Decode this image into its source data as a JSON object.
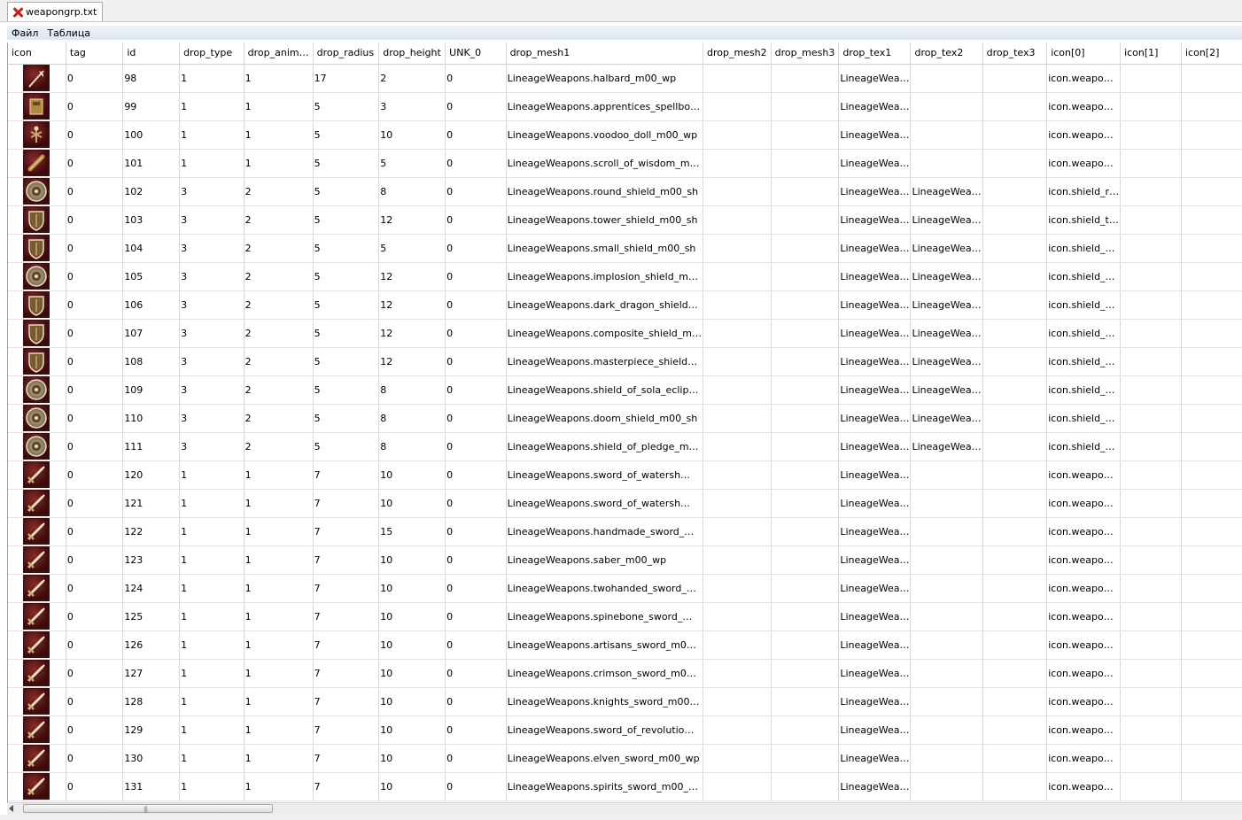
{
  "window": {
    "tab_title": "weapongrp.txt"
  },
  "menu": [
    "Файл",
    "Таблица"
  ],
  "columns": [
    "icon",
    "tag",
    "id",
    "drop_type",
    "drop_anim…",
    "drop_radius",
    "drop_height",
    "UNK_0",
    "drop_mesh1",
    "drop_mesh2",
    "drop_mesh3",
    "drop_tex1",
    "drop_tex2",
    "drop_tex3",
    "icon[0]",
    "icon[1]",
    "icon[2]"
  ],
  "rows": [
    {
      "icon": "halberd-icon",
      "tag": "0",
      "id": "98",
      "drop_type": "1",
      "drop_anim": "1",
      "drop_radius": "17",
      "drop_height": "2",
      "unk0": "0",
      "drop_mesh1": "LineageWeapons.halbard_m00_wp",
      "drop_tex1": "LineageWea…",
      "drop_tex2": "",
      "icon0": "icon.weapo…"
    },
    {
      "icon": "spellbook-icon",
      "tag": "0",
      "id": "99",
      "drop_type": "1",
      "drop_anim": "1",
      "drop_radius": "5",
      "drop_height": "3",
      "unk0": "0",
      "drop_mesh1": "LineageWeapons.apprentices_spellbo…",
      "drop_tex1": "LineageWea…",
      "drop_tex2": "",
      "icon0": "icon.weapo…"
    },
    {
      "icon": "voodoo-doll-icon",
      "tag": "0",
      "id": "100",
      "drop_type": "1",
      "drop_anim": "1",
      "drop_radius": "5",
      "drop_height": "10",
      "unk0": "0",
      "drop_mesh1": "LineageWeapons.voodoo_doll_m00_wp",
      "drop_tex1": "LineageWea…",
      "drop_tex2": "",
      "icon0": "icon.weapo…"
    },
    {
      "icon": "scroll-icon",
      "tag": "0",
      "id": "101",
      "drop_type": "1",
      "drop_anim": "1",
      "drop_radius": "5",
      "drop_height": "5",
      "unk0": "0",
      "drop_mesh1": "LineageWeapons.scroll_of_wisdom_m…",
      "drop_tex1": "LineageWea…",
      "drop_tex2": "",
      "icon0": "icon.weapo…"
    },
    {
      "icon": "round-shield-icon",
      "tag": "0",
      "id": "102",
      "drop_type": "3",
      "drop_anim": "2",
      "drop_radius": "5",
      "drop_height": "8",
      "unk0": "0",
      "drop_mesh1": "LineageWeapons.round_shield_m00_sh",
      "drop_tex1": "LineageWea…",
      "drop_tex2": "LineageWea…",
      "icon0": "icon.shield_r…"
    },
    {
      "icon": "tower-shield-icon",
      "tag": "0",
      "id": "103",
      "drop_type": "3",
      "drop_anim": "2",
      "drop_radius": "5",
      "drop_height": "12",
      "unk0": "0",
      "drop_mesh1": "LineageWeapons.tower_shield_m00_sh",
      "drop_tex1": "LineageWea…",
      "drop_tex2": "LineageWea…",
      "icon0": "icon.shield_t…"
    },
    {
      "icon": "small-shield-icon",
      "tag": "0",
      "id": "104",
      "drop_type": "3",
      "drop_anim": "2",
      "drop_radius": "5",
      "drop_height": "5",
      "unk0": "0",
      "drop_mesh1": "LineageWeapons.small_shield_m00_sh",
      "drop_tex1": "LineageWea…",
      "drop_tex2": "LineageWea…",
      "icon0": "icon.shield_…"
    },
    {
      "icon": "implosion-shield-icon",
      "tag": "0",
      "id": "105",
      "drop_type": "3",
      "drop_anim": "2",
      "drop_radius": "5",
      "drop_height": "12",
      "unk0": "0",
      "drop_mesh1": "LineageWeapons.implosion_shield_m…",
      "drop_tex1": "LineageWea…",
      "drop_tex2": "LineageWea…",
      "icon0": "icon.shield_…"
    },
    {
      "icon": "dark-dragon-shield-icon",
      "tag": "0",
      "id": "106",
      "drop_type": "3",
      "drop_anim": "2",
      "drop_radius": "5",
      "drop_height": "12",
      "unk0": "0",
      "drop_mesh1": "LineageWeapons.dark_dragon_shield…",
      "drop_tex1": "LineageWea…",
      "drop_tex2": "LineageWea…",
      "icon0": "icon.shield_…"
    },
    {
      "icon": "composite-shield-icon",
      "tag": "0",
      "id": "107",
      "drop_type": "3",
      "drop_anim": "2",
      "drop_radius": "5",
      "drop_height": "12",
      "unk0": "0",
      "drop_mesh1": "LineageWeapons.composite_shield_m…",
      "drop_tex1": "LineageWea…",
      "drop_tex2": "LineageWea…",
      "icon0": "icon.shield_…"
    },
    {
      "icon": "masterpiece-shield-icon",
      "tag": "0",
      "id": "108",
      "drop_type": "3",
      "drop_anim": "2",
      "drop_radius": "5",
      "drop_height": "12",
      "unk0": "0",
      "drop_mesh1": "LineageWeapons.masterpiece_shield…",
      "drop_tex1": "LineageWea…",
      "drop_tex2": "LineageWea…",
      "icon0": "icon.shield_…"
    },
    {
      "icon": "sola-eclipse-shield-icon",
      "tag": "0",
      "id": "109",
      "drop_type": "3",
      "drop_anim": "2",
      "drop_radius": "5",
      "drop_height": "8",
      "unk0": "0",
      "drop_mesh1": "LineageWeapons.shield_of_sola_eclip…",
      "drop_tex1": "LineageWea…",
      "drop_tex2": "LineageWea…",
      "icon0": "icon.shield_…"
    },
    {
      "icon": "doom-shield-icon",
      "tag": "0",
      "id": "110",
      "drop_type": "3",
      "drop_anim": "2",
      "drop_radius": "5",
      "drop_height": "8",
      "unk0": "0",
      "drop_mesh1": "LineageWeapons.doom_shield_m00_sh",
      "drop_tex1": "LineageWea…",
      "drop_tex2": "LineageWea…",
      "icon0": "icon.shield_…"
    },
    {
      "icon": "pledge-shield-icon",
      "tag": "0",
      "id": "111",
      "drop_type": "3",
      "drop_anim": "2",
      "drop_radius": "5",
      "drop_height": "8",
      "unk0": "0",
      "drop_mesh1": "LineageWeapons.shield_of_pledge_m…",
      "drop_tex1": "LineageWea…",
      "drop_tex2": "LineageWea…",
      "icon0": "icon.shield_…"
    },
    {
      "icon": "sword-icon",
      "tag": "0",
      "id": "120",
      "drop_type": "1",
      "drop_anim": "1",
      "drop_radius": "7",
      "drop_height": "10",
      "unk0": "0",
      "drop_mesh1": "LineageWeapons.sword_of_watersh…",
      "drop_tex1": "LineageWea…",
      "drop_tex2": "",
      "icon0": "icon.weapo…"
    },
    {
      "icon": "sword-icon",
      "tag": "0",
      "id": "121",
      "drop_type": "1",
      "drop_anim": "1",
      "drop_radius": "7",
      "drop_height": "10",
      "unk0": "0",
      "drop_mesh1": "LineageWeapons.sword_of_watersh…",
      "drop_tex1": "LineageWea…",
      "drop_tex2": "",
      "icon0": "icon.weapo…"
    },
    {
      "icon": "sword-icon",
      "tag": "0",
      "id": "122",
      "drop_type": "1",
      "drop_anim": "1",
      "drop_radius": "7",
      "drop_height": "15",
      "unk0": "0",
      "drop_mesh1": "LineageWeapons.handmade_sword_…",
      "drop_tex1": "LineageWea…",
      "drop_tex2": "",
      "icon0": "icon.weapo…"
    },
    {
      "icon": "saber-icon",
      "tag": "0",
      "id": "123",
      "drop_type": "1",
      "drop_anim": "1",
      "drop_radius": "7",
      "drop_height": "10",
      "unk0": "0",
      "drop_mesh1": "LineageWeapons.saber_m00_wp",
      "drop_tex1": "LineageWea…",
      "drop_tex2": "",
      "icon0": "icon.weapo…"
    },
    {
      "icon": "sword-icon",
      "tag": "0",
      "id": "124",
      "drop_type": "1",
      "drop_anim": "1",
      "drop_radius": "7",
      "drop_height": "10",
      "unk0": "0",
      "drop_mesh1": "LineageWeapons.twohanded_sword_…",
      "drop_tex1": "LineageWea…",
      "drop_tex2": "",
      "icon0": "icon.weapo…"
    },
    {
      "icon": "sword-icon",
      "tag": "0",
      "id": "125",
      "drop_type": "1",
      "drop_anim": "1",
      "drop_radius": "7",
      "drop_height": "10",
      "unk0": "0",
      "drop_mesh1": "LineageWeapons.spinebone_sword_…",
      "drop_tex1": "LineageWea…",
      "drop_tex2": "",
      "icon0": "icon.weapo…"
    },
    {
      "icon": "sword-icon",
      "tag": "0",
      "id": "126",
      "drop_type": "1",
      "drop_anim": "1",
      "drop_radius": "7",
      "drop_height": "10",
      "unk0": "0",
      "drop_mesh1": "LineageWeapons.artisans_sword_m0…",
      "drop_tex1": "LineageWea…",
      "drop_tex2": "",
      "icon0": "icon.weapo…"
    },
    {
      "icon": "sword-icon",
      "tag": "0",
      "id": "127",
      "drop_type": "1",
      "drop_anim": "1",
      "drop_radius": "7",
      "drop_height": "10",
      "unk0": "0",
      "drop_mesh1": "LineageWeapons.crimson_sword_m0…",
      "drop_tex1": "LineageWea…",
      "drop_tex2": "",
      "icon0": "icon.weapo…"
    },
    {
      "icon": "sword-icon",
      "tag": "0",
      "id": "128",
      "drop_type": "1",
      "drop_anim": "1",
      "drop_radius": "7",
      "drop_height": "10",
      "unk0": "0",
      "drop_mesh1": "LineageWeapons.knights_sword_m00…",
      "drop_tex1": "LineageWea…",
      "drop_tex2": "",
      "icon0": "icon.weapo…"
    },
    {
      "icon": "sword-icon",
      "tag": "0",
      "id": "129",
      "drop_type": "1",
      "drop_anim": "1",
      "drop_radius": "7",
      "drop_height": "10",
      "unk0": "0",
      "drop_mesh1": "LineageWeapons.sword_of_revolutio…",
      "drop_tex1": "LineageWea…",
      "drop_tex2": "",
      "icon0": "icon.weapo…"
    },
    {
      "icon": "sword-icon",
      "tag": "0",
      "id": "130",
      "drop_type": "1",
      "drop_anim": "1",
      "drop_radius": "7",
      "drop_height": "10",
      "unk0": "0",
      "drop_mesh1": "LineageWeapons.elven_sword_m00_wp",
      "drop_tex1": "LineageWea…",
      "drop_tex2": "",
      "icon0": "icon.weapo…"
    },
    {
      "icon": "sword-icon",
      "tag": "0",
      "id": "131",
      "drop_type": "1",
      "drop_anim": "1",
      "drop_radius": "7",
      "drop_height": "10",
      "unk0": "0",
      "drop_mesh1": "LineageWeapons.spirits_sword_m00_…",
      "drop_tex1": "LineageWea…",
      "drop_tex2": "",
      "icon0": "icon.weapo…"
    }
  ],
  "colors": {
    "icon_bg": "#5a1010",
    "grid_line": "#d8d8d8",
    "menubar": "#dde6f2",
    "close_x": "#d21919"
  }
}
